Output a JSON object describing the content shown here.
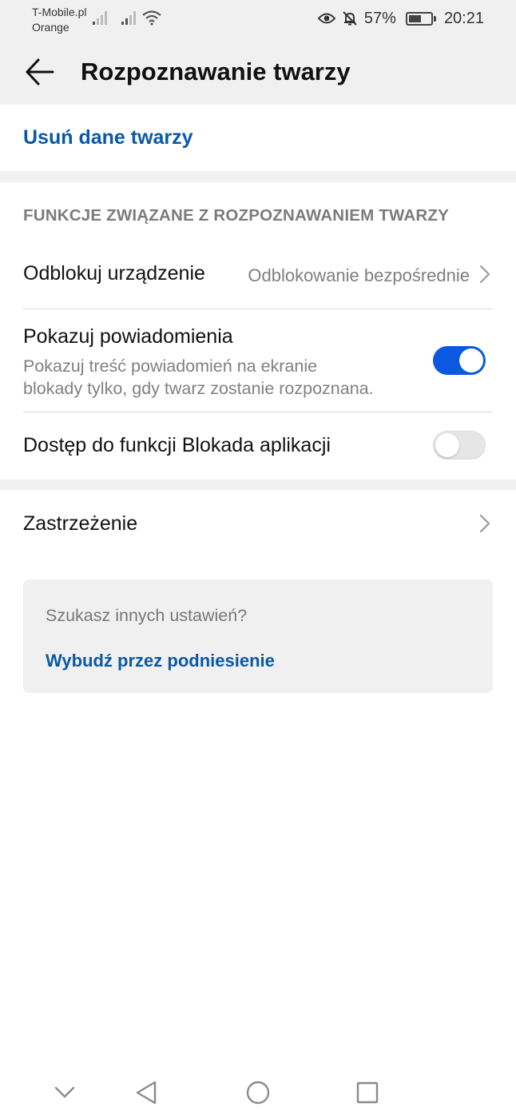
{
  "status_bar": {
    "carrier1": "T-Mobile.pl",
    "carrier2": "Orange",
    "battery_percent": "57%",
    "battery_level": 0.57,
    "time": "20:21",
    "icons": [
      "signal-icon",
      "signal-icon",
      "wifi-icon",
      "eye-icon",
      "bell-off-icon",
      "battery-icon"
    ]
  },
  "app_bar": {
    "title": "Rozpoznawanie twarzy",
    "back_icon": "arrow-left-icon"
  },
  "delete_face_label": "Usuń dane twarzy",
  "section": {
    "header": "FUNKCJE ZWIĄZANE Z ROZPOZNAWANIEM TWARZY",
    "unlock": {
      "title": "Odblokuj urządzenie",
      "value": "Odblokowanie bezpośrednie"
    },
    "notifications": {
      "title": "Pokazuj powiadomienia",
      "subtitle_line1": "Pokazuj treść powiadomień na ekranie",
      "subtitle_line2": "blokady tylko, gdy twarz zostanie rozpoznana.",
      "enabled": true
    },
    "app_lock": {
      "title": "Dostęp do funkcji Blokada aplikacji",
      "enabled": false
    }
  },
  "disclaimer_label": "Zastrzeżenie",
  "suggestion_card": {
    "title": "Szukasz innych ustawień?",
    "link": "Wybudź przez podniesienie"
  },
  "nav_bar": {
    "buttons": [
      "chevron-down-icon",
      "back-triangle-icon",
      "home-circle-icon",
      "recents-square-icon"
    ]
  },
  "colors": {
    "accent": "#0a59a5",
    "toggle_on": "#0a59e0",
    "background_gray": "#f0f0f0"
  }
}
